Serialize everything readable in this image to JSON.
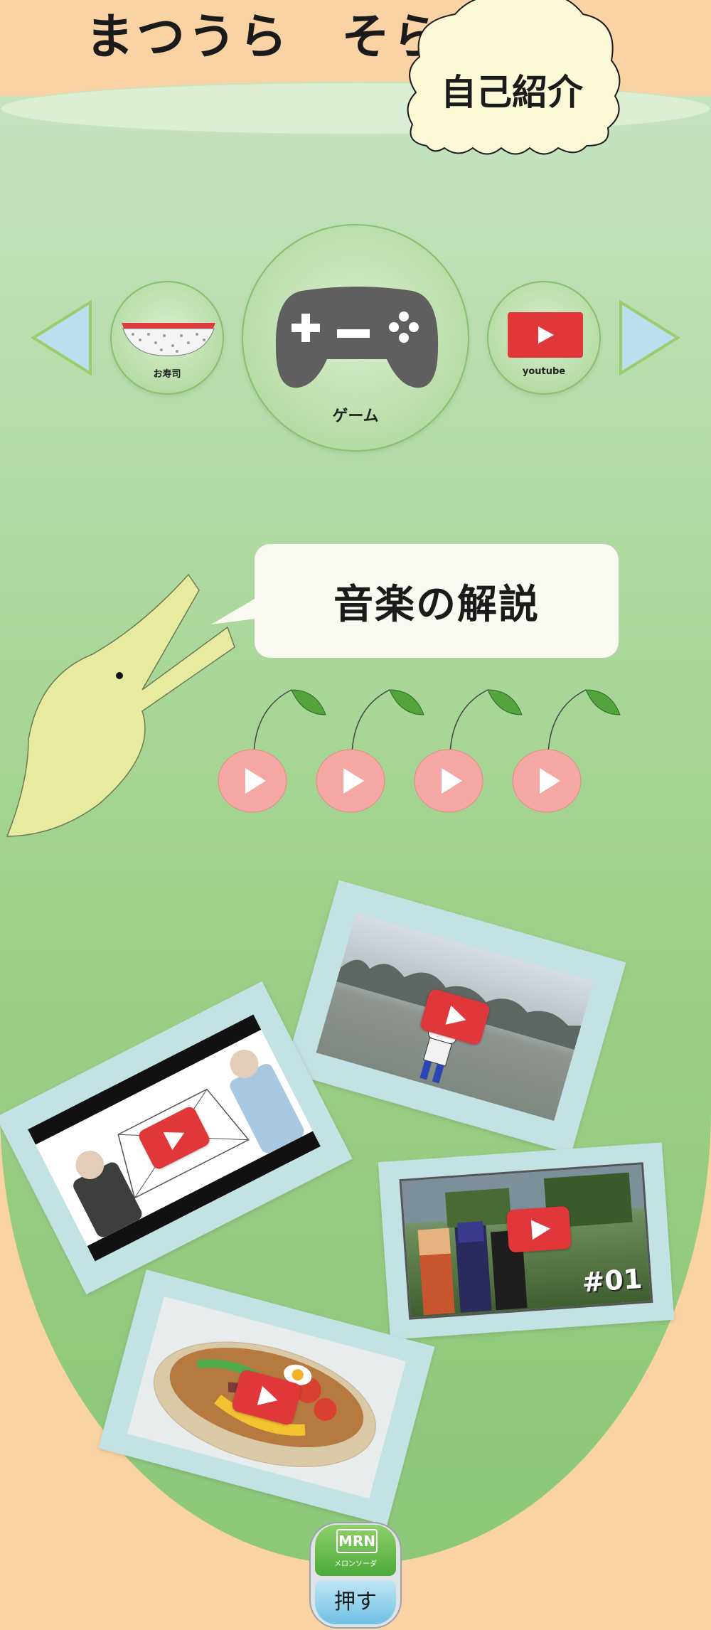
{
  "header": {
    "name": "まつうら　そら",
    "intro_label": "自己紹介"
  },
  "carousel": {
    "items": [
      {
        "label": "お寿司",
        "icon": "sushi-icon"
      },
      {
        "label": "ゲーム",
        "icon": "gamepad-icon"
      },
      {
        "label": "youtube",
        "icon": "youtube-icon"
      }
    ],
    "prev_icon": "triangle-left-icon",
    "next_icon": "triangle-right-icon"
  },
  "music": {
    "title": "音楽の解説",
    "tracks": [
      "cherry-play-1",
      "cherry-play-2",
      "cherry-play-3",
      "cherry-play-4"
    ]
  },
  "videos": {
    "cards": [
      {
        "name": "video-card-anime",
        "icon": "youtube-play-icon"
      },
      {
        "name": "video-card-duo",
        "icon": "youtube-play-icon"
      },
      {
        "name": "video-card-minecraft",
        "icon": "youtube-play-icon",
        "overlay": "#01"
      },
      {
        "name": "video-card-noodles",
        "icon": "youtube-play-icon"
      }
    ]
  },
  "push_button": {
    "brand": "MRN",
    "sub": "メロンソーダ",
    "label": "押す"
  },
  "colors": {
    "background": "#f9d3a3",
    "glass": "#9ccf86",
    "youtube_red": "#e0383a",
    "cherry": "#f4a7a3",
    "card": "#c3e2e4"
  }
}
